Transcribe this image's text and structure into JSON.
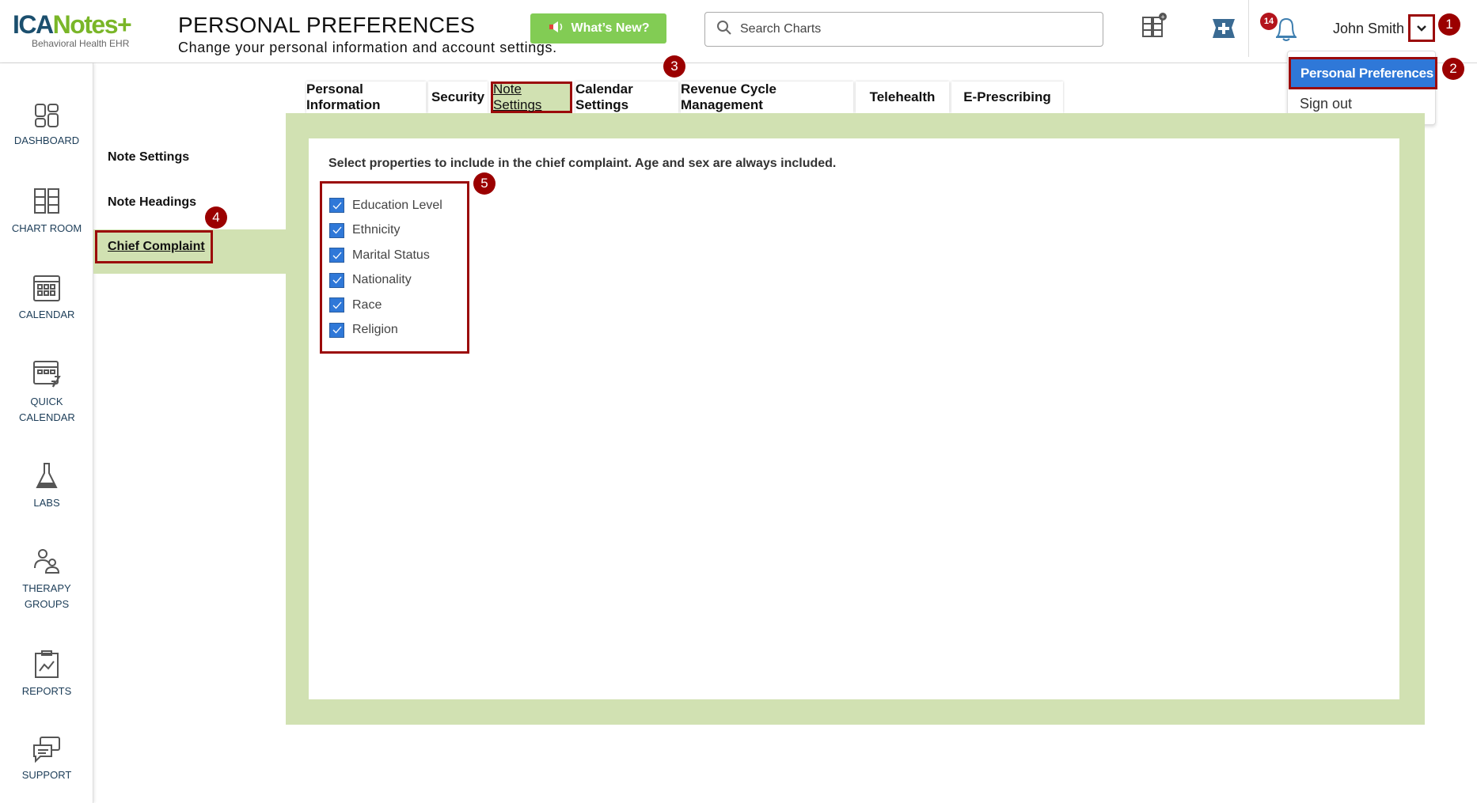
{
  "header": {
    "logo_text": "ICANotes",
    "logo_subtitle": "Behavioral Health EHR",
    "title": "PERSONAL PREFERENCES",
    "subtitle": "Change your personal information and account settings.",
    "whats_new": "What’s New?",
    "search_placeholder": "Search Charts",
    "notification_count": "14",
    "user_name": "John Smith"
  },
  "user_menu": {
    "items": [
      "Personal Preferences",
      "Sign out"
    ]
  },
  "sidebar": {
    "items": [
      {
        "label": "DASHBOARD"
      },
      {
        "label": "CHART ROOM"
      },
      {
        "label": "CALENDAR"
      },
      {
        "label": "QUICK CALENDAR"
      },
      {
        "label": "LABS"
      },
      {
        "label": "THERAPY GROUPS"
      },
      {
        "label": "REPORTS"
      },
      {
        "label": "SUPPORT"
      }
    ]
  },
  "subnav": {
    "items": [
      "Note Settings",
      "Note Headings",
      "Chief Complaint"
    ]
  },
  "tabs": [
    "Personal Information",
    "Security",
    "Note Settings",
    "Calendar Settings",
    "Revenue Cycle Management",
    "Telehealth",
    "E-Prescribing"
  ],
  "content": {
    "instruction": "Select properties to include in the chief complaint. Age and sex are always included.",
    "properties": [
      {
        "label": "Education Level",
        "checked": true
      },
      {
        "label": "Ethnicity",
        "checked": true
      },
      {
        "label": "Marital Status",
        "checked": true
      },
      {
        "label": "Nationality",
        "checked": true
      },
      {
        "label": "Race",
        "checked": true
      },
      {
        "label": "Religion",
        "checked": true
      }
    ]
  },
  "steps": [
    "1",
    "2",
    "3",
    "4",
    "5"
  ],
  "colors": {
    "accent_green": "#d1e1b2",
    "checkbox_blue": "#2f78d8",
    "step_red": "#9b0000",
    "whats_new_green": "#82cc54"
  }
}
